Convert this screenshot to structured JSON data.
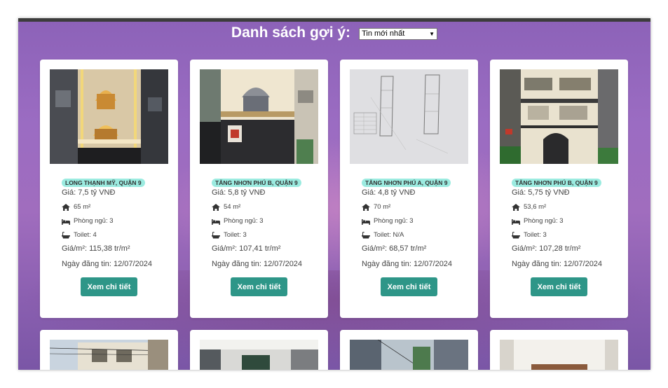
{
  "header": {
    "title": "Danh sách gợi ý:",
    "sort_selected": "Tin mới nhất"
  },
  "listings": [
    {
      "district": "LONG THẠNH MỸ, QUẬN 9",
      "price": "Giá: 7,5 tỷ VNĐ",
      "area": "65 m²",
      "bedrooms": "Phòng ngủ: 3",
      "toilets": "Toilet: 4",
      "price_per_m2": "Giá/m²: 115,38 tr/m²",
      "posted": "Ngày đăng tin: 12/07/2024",
      "button": "Xem chi tiết"
    },
    {
      "district": "TĂNG NHƠN PHÚ B, QUẬN 9",
      "price": "Giá: 5,8 tỷ VNĐ",
      "area": "54 m²",
      "bedrooms": "Phòng ngủ: 3",
      "toilets": "Toilet: 3",
      "price_per_m2": "Giá/m²: 107,41 tr/m²",
      "posted": "Ngày đăng tin: 12/07/2024",
      "button": "Xem chi tiết"
    },
    {
      "district": "TĂNG NHƠN PHÚ A, QUẬN 9",
      "price": "Giá: 4,8 tỷ VNĐ",
      "area": "70 m²",
      "bedrooms": "Phòng ngủ: 3",
      "toilets": "Toilet: N/A",
      "price_per_m2": "Giá/m²: 68,57 tr/m²",
      "posted": "Ngày đăng tin: 12/07/2024",
      "button": "Xem chi tiết"
    },
    {
      "district": "TĂNG NHƠN PHÚ B, QUẬN 9",
      "price": "Giá: 5,75 tỷ VNĐ",
      "area": "53,6 m²",
      "bedrooms": "Phòng ngủ: 3",
      "toilets": "Toilet: 3",
      "price_per_m2": "Giá/m²: 107,28 tr/m²",
      "posted": "Ngày đăng tin: 12/07/2024",
      "button": "Xem chi tiết"
    }
  ],
  "icons": {
    "area": "home-icon",
    "bedrooms": "bed-icon",
    "toilets": "bathtub-icon"
  },
  "colors": {
    "accent": "#2e9688",
    "badge": "#9bebe0",
    "background": "#9b6cc2"
  }
}
